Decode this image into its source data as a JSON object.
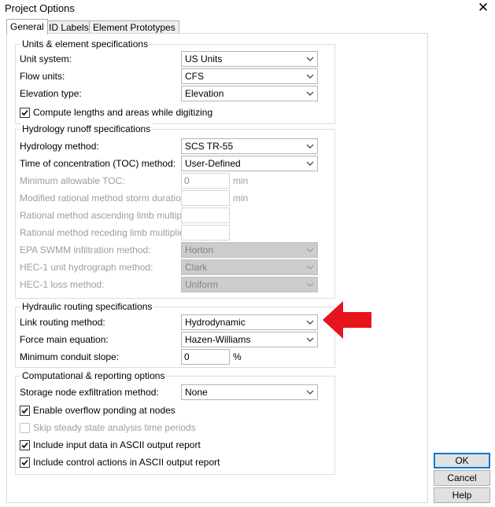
{
  "window": {
    "title": "Project Options"
  },
  "tabs": [
    {
      "label": "General",
      "active": true
    },
    {
      "label": "ID Labels",
      "active": false
    },
    {
      "label": "Element Prototypes",
      "active": false
    }
  ],
  "units": {
    "title": "Units & element specifications",
    "unit_system": {
      "label": "Unit system:",
      "value": "US Units"
    },
    "flow_units": {
      "label": "Flow units:",
      "value": "CFS"
    },
    "elevation_type": {
      "label": "Elevation type:",
      "value": "Elevation"
    },
    "compute_lengths": {
      "label": "Compute lengths and areas while digitizing",
      "checked": true
    }
  },
  "hydrology": {
    "title": "Hydrology runoff specifications",
    "method": {
      "label": "Hydrology method:",
      "value": "SCS TR-55"
    },
    "toc_method": {
      "label": "Time of concentration (TOC) method:",
      "value": "User-Defined"
    },
    "min_toc": {
      "label": "Minimum allowable TOC:",
      "value": "0",
      "unit": "min"
    },
    "storm_duration": {
      "label": "Modified rational method storm duration:",
      "value": "",
      "unit": "min"
    },
    "ascending": {
      "label": "Rational method ascending limb multiplier:",
      "value": ""
    },
    "receding": {
      "label": "Rational method receding limb multiplier:",
      "value": ""
    },
    "epa_infiltration": {
      "label": "EPA SWMM infiltration method:",
      "value": "Horton"
    },
    "hec1_hydrograph": {
      "label": "HEC-1 unit hydrograph method:",
      "value": "Clark"
    },
    "hec1_loss": {
      "label": "HEC-1 loss method:",
      "value": "Uniform"
    }
  },
  "hydraulic": {
    "title": "Hydraulic routing specifications",
    "link_routing": {
      "label": "Link routing method:",
      "value": "Hydrodynamic"
    },
    "force_main": {
      "label": "Force main equation:",
      "value": "Hazen-Williams"
    },
    "min_slope": {
      "label": "Minimum conduit slope:",
      "value": "0",
      "unit": "%"
    }
  },
  "computational": {
    "title": "Computational & reporting options",
    "storage_exfiltration": {
      "label": "Storage node exfiltration method:",
      "value": "None"
    },
    "overflow_ponding": {
      "label": "Enable overflow ponding at nodes",
      "checked": true
    },
    "skip_steady": {
      "label": "Skip steady state analysis time periods",
      "checked": false
    },
    "include_input": {
      "label": "Include input data in ASCII output report",
      "checked": true
    },
    "include_control": {
      "label": "Include control actions in ASCII output report",
      "checked": true
    }
  },
  "buttons": {
    "ok": "OK",
    "cancel": "Cancel",
    "help": "Help"
  },
  "annotation": {
    "arrow_color": "#e8141c"
  }
}
